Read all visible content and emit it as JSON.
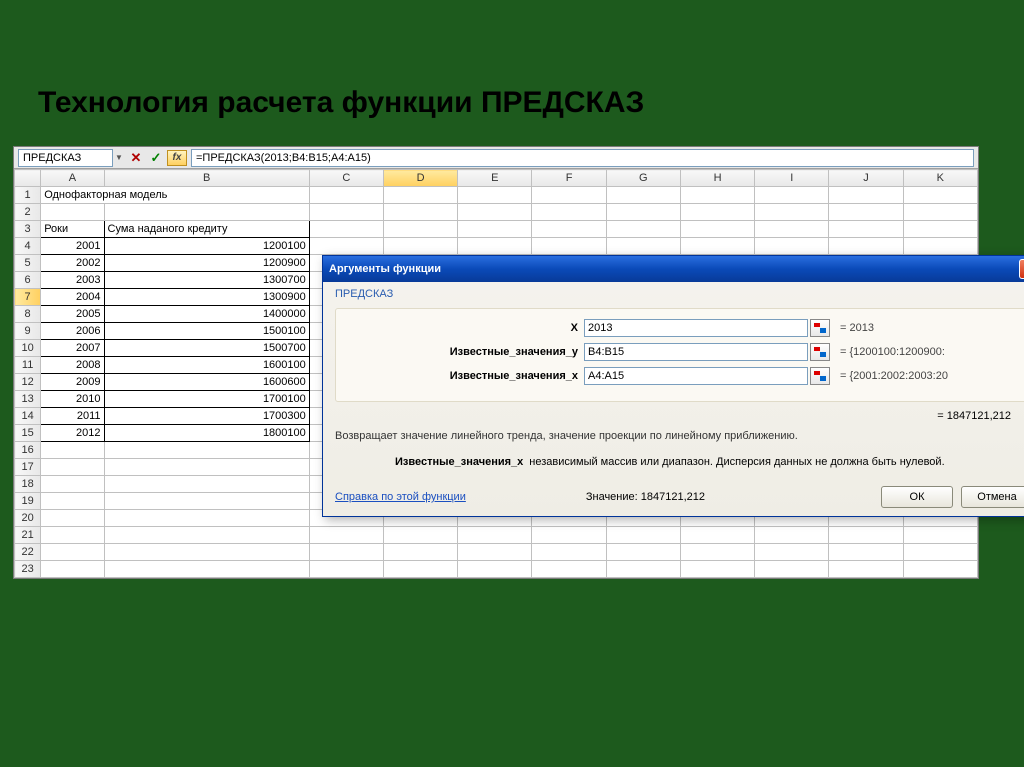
{
  "slide": {
    "title": "Технология расчета функции ПРЕДСКАЗ"
  },
  "formula_bar": {
    "namebox": "ПРЕДСКАЗ",
    "formula": "=ПРЕДСКАЗ(2013;B4:B15;A4:A15)"
  },
  "columns": [
    "A",
    "B",
    "C",
    "D",
    "E",
    "F",
    "G",
    "H",
    "I",
    "J",
    "K"
  ],
  "rows": [
    "1",
    "2",
    "3",
    "4",
    "5",
    "6",
    "7",
    "8",
    "9",
    "10",
    "11",
    "12",
    "13",
    "14",
    "15",
    "16",
    "17",
    "18",
    "19",
    "20",
    "21",
    "22",
    "23"
  ],
  "cells": {
    "a1": "Однофакторная модель",
    "a3": "Роки",
    "b3": "Сума наданого кредиту",
    "a4": "2001",
    "b4": "1200100",
    "a5": "2002",
    "b5": "1200900",
    "a6": "2003",
    "b6": "1300700",
    "a7": "2004",
    "b7": "1300900",
    "a8": "2005",
    "b8": "1400000",
    "a9": "2006",
    "b9": "1500100",
    "a10": "2007",
    "b10": "1500700",
    "a11": "2008",
    "b11": "1600100",
    "a12": "2009",
    "b12": "1600600",
    "a13": "2010",
    "b13": "1700100",
    "a14": "2011",
    "b14": "1700300",
    "a15": "2012",
    "b15": "1800100"
  },
  "dialog": {
    "title": "Аргументы функции",
    "func": "ПРЕДСКАЗ",
    "args": [
      {
        "label": "X",
        "value": "2013",
        "result": "= 2013"
      },
      {
        "label": "Известные_значения_y",
        "value": "B4:B15",
        "result": "= {1200100:1200900:"
      },
      {
        "label": "Известные_значения_x",
        "value": "A4:A15",
        "result": "= {2001:2002:2003:20"
      }
    ],
    "overall_result": "= 1847121,212",
    "description": "Возвращает значение линейного тренда, значение проекции по линейному приближению.",
    "arg_desc_label": "Известные_значения_x",
    "arg_desc_text": "независимый массив или диапазон. Дисперсия данных не должна быть нулевой.",
    "help_link": "Справка по этой функции",
    "value_label": "Значение: 1847121,212",
    "ok": "ОК",
    "cancel": "Отмена"
  }
}
